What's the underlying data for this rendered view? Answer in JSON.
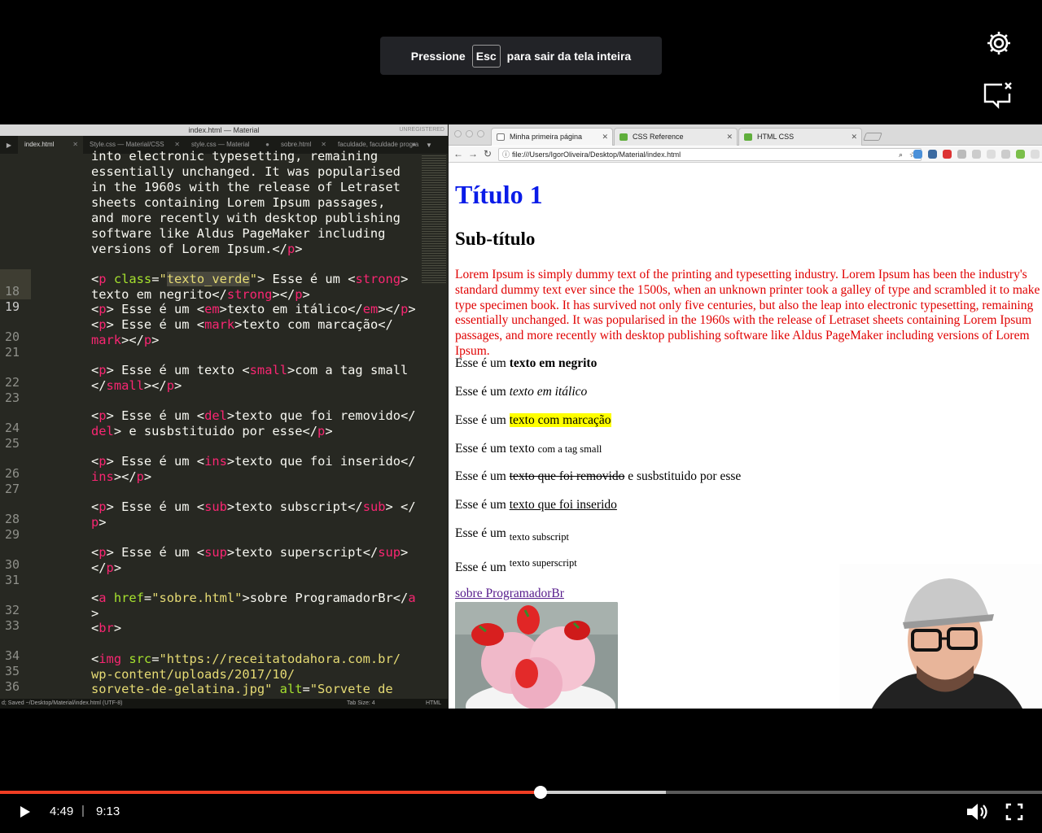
{
  "fullscreen_banner": {
    "prefix": "Pressione",
    "key": "Esc",
    "suffix": "para sair da tela inteira"
  },
  "icons": {
    "settings": "gear-icon",
    "feedback": "report-icon",
    "play": "play-icon",
    "volume": "volume-icon",
    "fullscreen": "exit-fullscreen-icon"
  },
  "editor": {
    "window_title": "index.html — Material",
    "license": "UNREGISTERED",
    "tabs": [
      "index.html",
      "Style.css — Material/CSS",
      "style.css — Material",
      "sobre.html",
      "faculdade, faculdade progra"
    ],
    "line_numbers": [
      "18",
      "19",
      "20",
      "21",
      "22",
      "23",
      "24",
      "25",
      "26",
      "27",
      "28",
      "29",
      "30",
      "31",
      "32",
      "33",
      "34",
      "35",
      "36"
    ],
    "status_left": "d; Saved ~/Desktop/Material/index.html (UTF-8)",
    "status_tab": "Tab Size: 4",
    "status_syntax": "HTML",
    "code": {
      "l0": "into electronic typesetting, remaining",
      "l1": "essentially unchanged. It was popularised",
      "l2": "in the 1960s with the release of Letraset",
      "l3": "sheets containing Lorem Ipsum passages,",
      "l4": "and more recently with desktop publishing",
      "l5": "software like Aldus PageMaker including",
      "l6": "versions of Lorem Ipsum.",
      "p19a": " Esse é um ",
      "p19b": "texto em negrito",
      "p20a": " Esse é um ",
      "p20b": "texto em itálico",
      "p21a": " Esse é um ",
      "p21b": "texto com marcação",
      "p23a": " Esse é um texto ",
      "p23b": "com a tag small",
      "p25a": " Esse é um ",
      "p25b": "texto que foi removido",
      "p25c": " e susbstituido por esse",
      "p27a": " Esse é um ",
      "p27b": "texto que foi inserido",
      "p29a": " Esse é um ",
      "p29b": "texto subscript",
      "p31a": " Esse é um ",
      "p31b": "texto superscript",
      "class_value": "texto_verde",
      "href_value": "sobre.html",
      "a_text": "sobre ProgramadorBr",
      "img_src_1": "\"https://receitatodahora.com.br/",
      "img_src_2": "wp-content/uploads/2017/10/",
      "img_src_3": "sorvete-de-gelatina.jpg\"",
      "alt_value": "\"Sorvete de"
    }
  },
  "browser": {
    "tabs": [
      {
        "title": "Minha primeira página",
        "active": true
      },
      {
        "title": "CSS Reference",
        "active": false
      },
      {
        "title": "HTML CSS",
        "active": false
      }
    ],
    "address": "file:///Users/IgorOliveira/Desktop/Material/index.html",
    "page": {
      "h1": "Título 1",
      "h2": "Sub-título",
      "lorem": "Lorem Ipsum is simply dummy text of the printing and typesetting industry. Lorem Ipsum has been the industry's standard dummy text ever since the 1500s, when an unknown printer took a galley of type and scrambled it to make a type specimen book. It has survived not only five centuries, but also the leap into electronic typesetting, remaining essentially unchanged. It was popularised in the 1960s with the release of Letraset sheets containing Lorem Ipsum passages, and more recently with desktop publishing software like Aldus PageMaker including versions of Lorem Ipsum.",
      "prefix": "Esse é um ",
      "prefix_text": "Esse é um texto ",
      "strong": "texto em negrito",
      "em": "texto em itálico",
      "mark": "texto com marcação",
      "small": "com a tag small",
      "del": "texto que foi removido",
      "del_suffix": " e susbstituido por esse",
      "ins": "texto que foi inserido",
      "sub": "texto subscript",
      "sup": "texto superscript",
      "link": "sobre ProgramadorBr"
    }
  },
  "player": {
    "current_time": "4:49",
    "separator": "|",
    "duration": "9:13",
    "played_fraction": 0.519,
    "buffered_fraction": 0.639,
    "accent_color": "#ef3e23"
  }
}
